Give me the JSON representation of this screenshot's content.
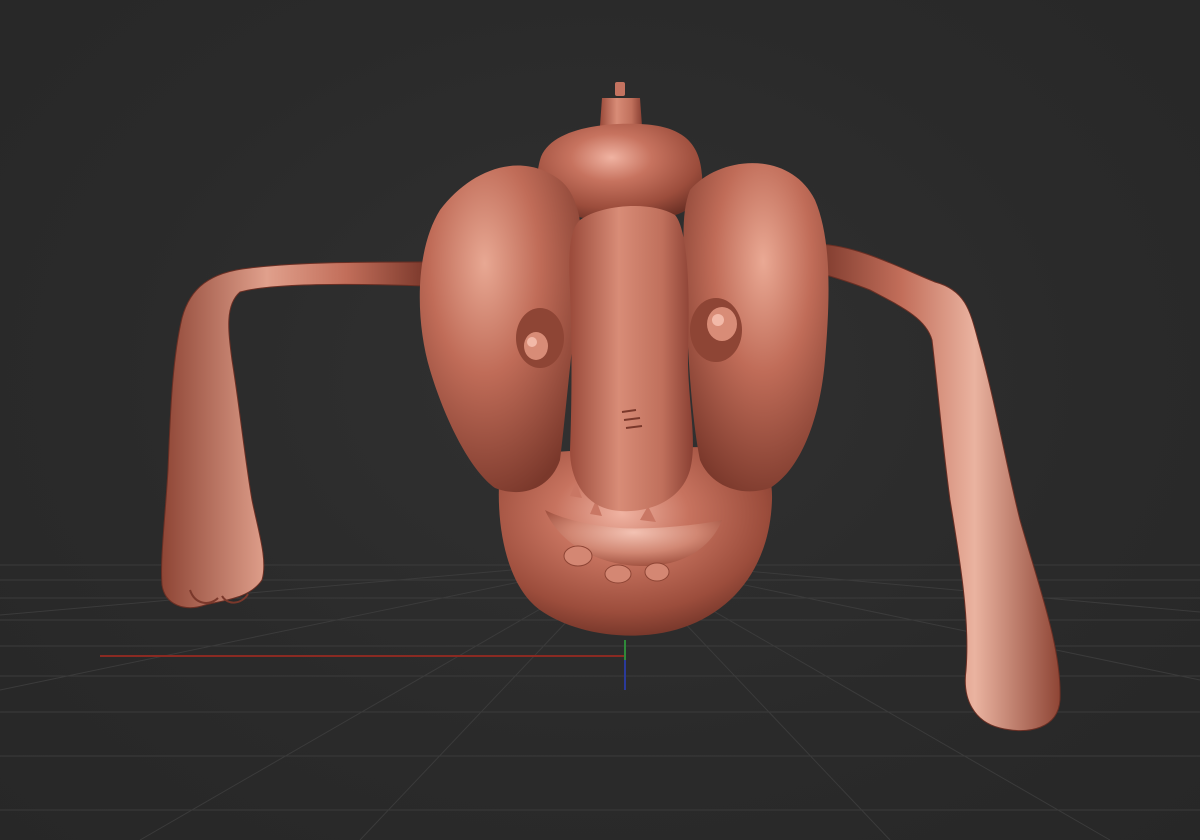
{
  "viewport": {
    "background_color": "#2b2b2b",
    "grid_color": "#3d3d3d",
    "x_axis_color": "#8a2a22",
    "y_axis_color": "#2f8a3a",
    "z_axis_color": "#2a3a9a"
  },
  "model": {
    "material_color": "#b86a58",
    "material_shadow_color": "#6e3327",
    "material_highlight_color": "#f2b9a8"
  }
}
